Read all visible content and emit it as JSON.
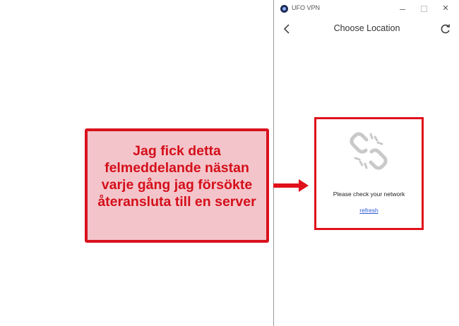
{
  "window": {
    "title": "UFO VPN",
    "minimize_label": "–",
    "maximize_label": "",
    "close_label": "✕"
  },
  "navbar": {
    "title": "Choose Location",
    "back_icon": "chevron-left-icon",
    "refresh_icon": "refresh-icon"
  },
  "error_panel": {
    "icon": "broken-link-icon",
    "message": "Please check your network",
    "refresh_link": "refresh"
  },
  "annotation": {
    "text": "Jag fick detta felmeddelande nästan varje gång jag försökte återansluta till en server",
    "border_color": "#d9121e",
    "fill_color": "#f3c5cb",
    "text_color": "#d40f1a"
  },
  "colors": {
    "highlight_red": "#e0111b",
    "link_blue": "#2d5bd7"
  }
}
